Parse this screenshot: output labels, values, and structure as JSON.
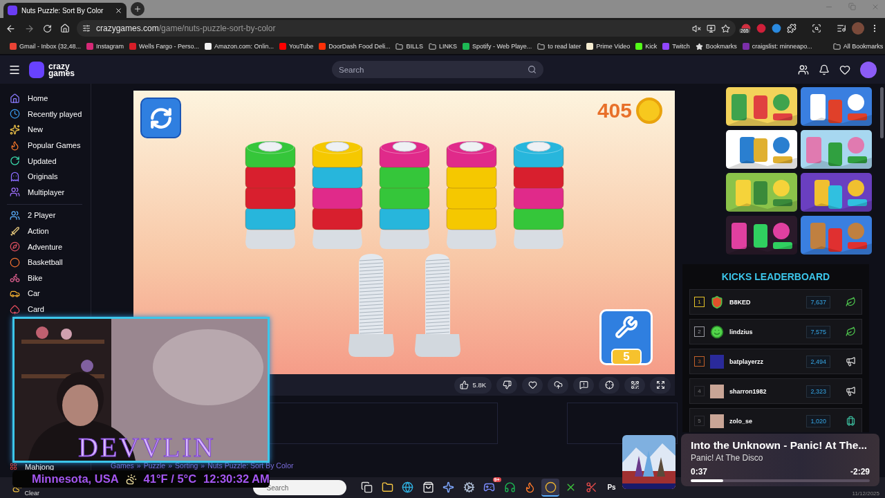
{
  "browser": {
    "tab_title": "Nuts Puzzle: Sort By Color",
    "url_domain": "crazygames.com",
    "url_path": "/game/nuts-puzzle-sort-by-color",
    "extension_badge": "265",
    "bookmarks": [
      {
        "label": "Gmail - Inbox (32,48...",
        "kind": "site",
        "color": "#ea4335"
      },
      {
        "label": "Instagram",
        "kind": "site",
        "color": "#d62976"
      },
      {
        "label": "Wells Fargo - Perso...",
        "kind": "site",
        "color": "#d71e28"
      },
      {
        "label": "Amazon.com: Onlin...",
        "kind": "site",
        "color": "#f2f2f2"
      },
      {
        "label": "YouTube",
        "kind": "site",
        "color": "#ff0000"
      },
      {
        "label": "DoorDash Food Deli...",
        "kind": "site",
        "color": "#ff3008"
      },
      {
        "label": "BILLS",
        "kind": "folder"
      },
      {
        "label": "LINKS",
        "kind": "folder"
      },
      {
        "label": "Spotify - Web Playe...",
        "kind": "site",
        "color": "#1db954"
      },
      {
        "label": "to read later",
        "kind": "folder"
      },
      {
        "label": "Prime Video",
        "kind": "site",
        "color": "#f5ecd0"
      },
      {
        "label": "Kick",
        "kind": "site",
        "color": "#53fc18"
      },
      {
        "label": "Twitch",
        "kind": "site",
        "color": "#9146ff"
      },
      {
        "label": "Bookmarks",
        "kind": "star"
      },
      {
        "label": "craigslist: minneapo...",
        "kind": "site",
        "color": "#7b2fa8"
      }
    ],
    "all_bookmarks": "All Bookmarks"
  },
  "site": {
    "logo_top": "crazy",
    "logo_bottom": "games",
    "search_placeholder": "Search"
  },
  "sidebar": {
    "primary": [
      {
        "label": "Home",
        "kind": "home"
      },
      {
        "label": "Recently played",
        "kind": "clock"
      },
      {
        "label": "New",
        "kind": "sparkles"
      },
      {
        "label": "Popular Games",
        "kind": "flame"
      },
      {
        "label": "Updated",
        "kind": "refresh"
      },
      {
        "label": "Originals",
        "kind": "ghost"
      },
      {
        "label": "Multiplayer",
        "kind": "users"
      }
    ],
    "categories": [
      {
        "label": "2 Player",
        "kind": "pair"
      },
      {
        "label": "Action",
        "kind": "sword"
      },
      {
        "label": "Adventure",
        "kind": "compass"
      },
      {
        "label": "Basketball",
        "kind": "ball"
      },
      {
        "label": "Bike",
        "kind": "bike"
      },
      {
        "label": "Car",
        "kind": "car"
      },
      {
        "label": "Card",
        "kind": "cards"
      }
    ],
    "lower": [
      {
        "label": "Mahjong",
        "kind": "tiles"
      }
    ]
  },
  "game": {
    "coins": "405",
    "extra_bolt_count": "5",
    "bolts": [
      {
        "kind": "filled",
        "nuts": [
          {
            "color": "#35c63a"
          },
          {
            "color": "#d81f2e"
          },
          {
            "color": "#d81f2e"
          },
          {
            "color": "#27b6dc"
          }
        ]
      },
      {
        "kind": "filled",
        "nuts": [
          {
            "color": "#f5c800"
          },
          {
            "color": "#27b6dc"
          },
          {
            "color": "#e02a8a"
          },
          {
            "color": "#d81f2e"
          }
        ]
      },
      {
        "kind": "filled",
        "nuts": [
          {
            "color": "#e02a8a"
          },
          {
            "color": "#35c63a"
          },
          {
            "color": "#35c63a"
          },
          {
            "color": "#27b6dc"
          }
        ]
      },
      {
        "kind": "filled",
        "nuts": [
          {
            "color": "#e02a8a"
          },
          {
            "color": "#f5c800"
          },
          {
            "color": "#f5c800"
          },
          {
            "color": "#f5c800"
          }
        ]
      },
      {
        "kind": "filled",
        "nuts": [
          {
            "color": "#27b6dc"
          },
          {
            "color": "#d81f2e"
          },
          {
            "color": "#e02a8a"
          },
          {
            "color": "#35c63a"
          }
        ]
      },
      {
        "kind": "empty"
      },
      {
        "kind": "empty"
      }
    ]
  },
  "game_toolbar": [
    {
      "kind": "like",
      "label": "5.8K"
    },
    {
      "kind": "dislike"
    },
    {
      "kind": "favorite"
    },
    {
      "kind": "cloud"
    },
    {
      "kind": "report"
    },
    {
      "kind": "target"
    },
    {
      "kind": "qr"
    },
    {
      "kind": "fullscreen"
    }
  ],
  "breadcrumbs": [
    {
      "label": "Games",
      "separator": "»"
    },
    {
      "label": "Puzzle",
      "separator": "»"
    },
    {
      "label": "Sorting",
      "separator": "»"
    },
    {
      "label": "Nuts Puzzle: Sort By Color"
    }
  ],
  "leaderboard": {
    "title": "KICKS LEADERBOARD",
    "rows": [
      {
        "rank": "1",
        "color": "#e6c229",
        "avatar": {
          "kind": "shield"
        },
        "name": "B8KED",
        "score": "7,637",
        "prize": {
          "kind": "leaf"
        }
      },
      {
        "rank": "2",
        "color": "#9a9aa2",
        "avatar": {
          "kind": "blob"
        },
        "name": "lindzius",
        "score": "7,575",
        "prize": {
          "kind": "leaf"
        }
      },
      {
        "rank": "3",
        "color": "#c0602a",
        "avatar": {
          "kind": "banner"
        },
        "name": "batplayerzz",
        "score": "2,494",
        "prize": {
          "kind": "megaphone"
        }
      },
      {
        "rank": "4",
        "color": "#2a2a30",
        "name": "sharron1982",
        "score": "2,323",
        "prize": {
          "kind": "megaphone"
        }
      },
      {
        "rank": "5",
        "color": "#2a2a30",
        "name": "zolo_se",
        "score": "1,020",
        "prize": {
          "kind": "luggage"
        }
      }
    ]
  },
  "stream_overlay": {
    "name": "DEVVLIN",
    "location": "Minnesota, USA",
    "temperature": "41°F / 5°C",
    "time": "12:30:32 AM"
  },
  "now_playing": {
    "title": "Into the Unknown - Panic! At The...",
    "artist": "Panic! At The Disco",
    "elapsed": "0:37",
    "remaining": "-2:29",
    "level": 0.18
  },
  "taskbar": {
    "weather": "Clear",
    "search_placeholder": "Search",
    "date": "11/12/2025",
    "apps": [
      {
        "kind": "taskview",
        "selected": false
      },
      {
        "kind": "folder",
        "selected": false
      },
      {
        "kind": "globe",
        "selected": false
      },
      {
        "kind": "store",
        "selected": false
      },
      {
        "kind": "sparkle",
        "selected": false
      },
      {
        "kind": "gear",
        "selected": false
      },
      {
        "kind": "gamepad",
        "selected": false,
        "badge": "9+"
      },
      {
        "kind": "music",
        "selected": false
      },
      {
        "kind": "flame",
        "selected": false
      },
      {
        "kind": "circle",
        "selected": true
      },
      {
        "kind": "cross",
        "selected": false
      },
      {
        "kind": "scissors",
        "selected": false
      },
      {
        "kind": "text",
        "label": "Ps",
        "selected": false
      }
    ]
  }
}
